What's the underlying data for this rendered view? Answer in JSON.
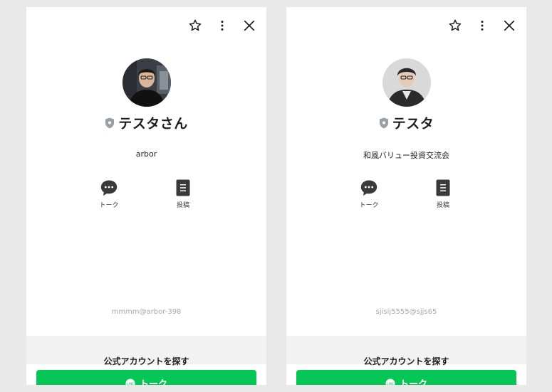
{
  "profiles": [
    {
      "name": "テスタさん",
      "status": "arbor",
      "user_id": "mmmm@arbor-398",
      "actions": [
        {
          "icon": "chat-bubble-icon",
          "label": "トーク"
        },
        {
          "icon": "post-icon",
          "label": "投稿"
        }
      ],
      "explore_label": "公式アカウントを探す",
      "talk_button_label": "トーク"
    },
    {
      "name": "テスタ",
      "status": "和風バリュー投資交流会",
      "user_id": "sjisij5555@sjjs65",
      "actions": [
        {
          "icon": "chat-bubble-icon",
          "label": "トーク"
        },
        {
          "icon": "post-icon",
          "label": "投稿"
        }
      ],
      "explore_label": "公式アカウントを探す",
      "talk_button_label": "トーク"
    }
  ],
  "colors": {
    "accent": "#06c755",
    "background": "#e9e9e9",
    "badge": "#9aa0a6",
    "user_id": "#a9a9a9"
  }
}
